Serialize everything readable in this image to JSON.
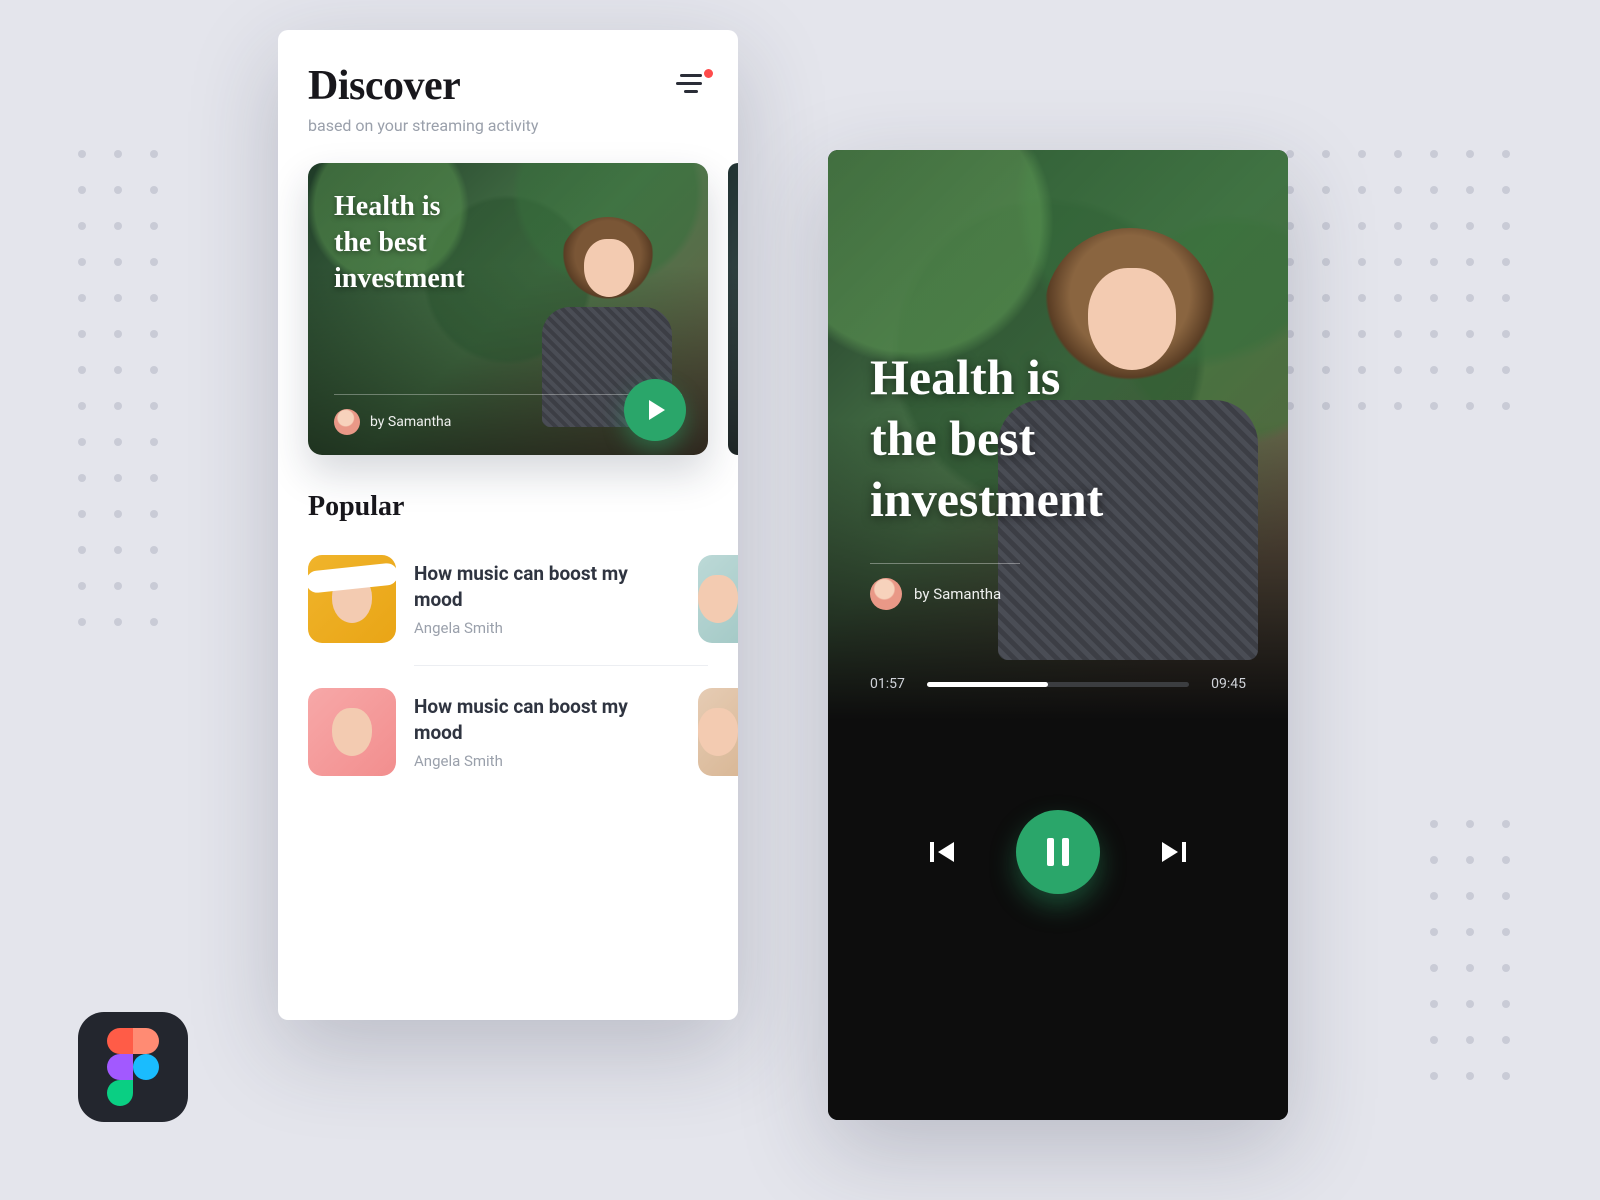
{
  "colors": {
    "accent": "#2aa66a",
    "badge": "#ff4b4b"
  },
  "discover": {
    "title": "Discover",
    "subtitle": "based on your streaming activity",
    "feature": {
      "title_line1": "Health is",
      "title_line2": "the best",
      "title_line3": "investment",
      "byline_prefix": "by",
      "author": "Samantha"
    },
    "popular_heading": "Popular",
    "popular": [
      {
        "title": "How music can boost my mood",
        "author": "Angela Smith"
      },
      {
        "title": "How music can boost my mood",
        "author": "Angela Smith"
      }
    ]
  },
  "player": {
    "title_line1": "Health is",
    "title_line2": "the best",
    "title_line3": "investment",
    "byline_prefix": "by",
    "author": "Samantha",
    "elapsed": "01:57",
    "duration": "09:45",
    "progress_percent": 46
  }
}
